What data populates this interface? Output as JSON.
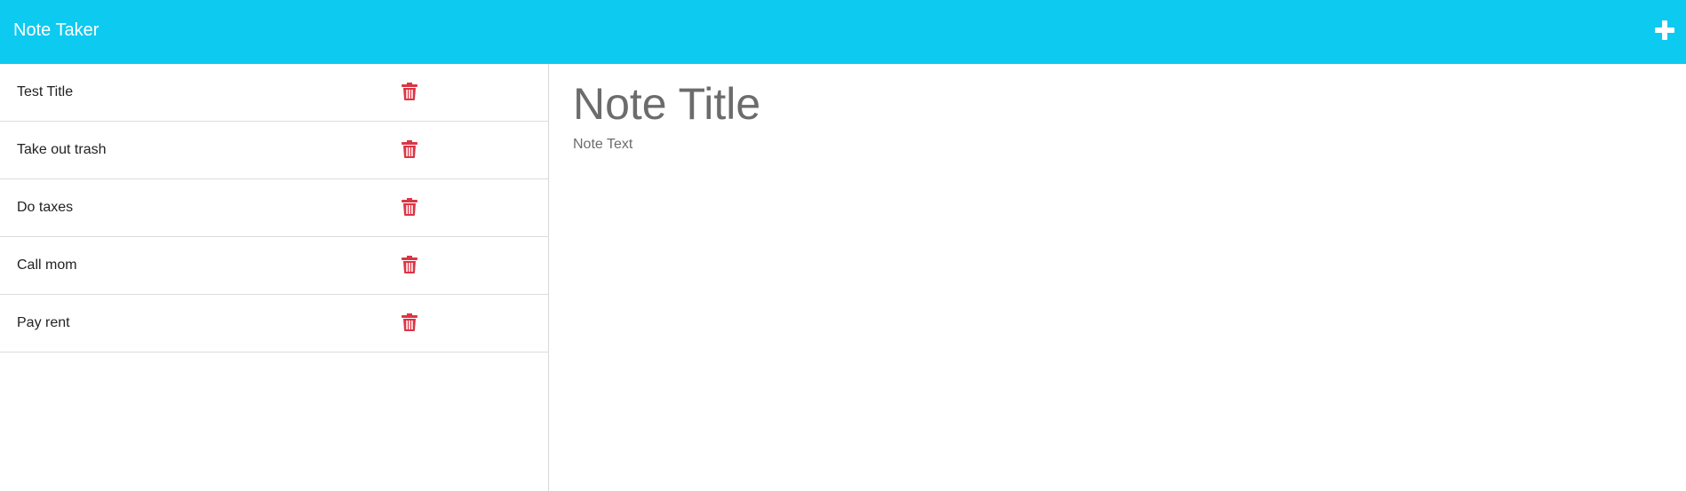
{
  "app": {
    "brand": "Note Taker",
    "new_note_icon": "plus-icon",
    "accent_color": "#0dcaf0"
  },
  "notes": [
    {
      "title": "Test Title",
      "delete_icon": "trash-icon"
    },
    {
      "title": "Take out trash",
      "delete_icon": "trash-icon"
    },
    {
      "title": "Do taxes",
      "delete_icon": "trash-icon"
    },
    {
      "title": "Call mom",
      "delete_icon": "trash-icon"
    },
    {
      "title": "Pay rent",
      "delete_icon": "trash-icon"
    }
  ],
  "editor": {
    "title_placeholder": "Note Title",
    "title_value": "",
    "text_placeholder": "Note Text",
    "text_value": ""
  },
  "colors": {
    "delete": "#dc3545"
  }
}
